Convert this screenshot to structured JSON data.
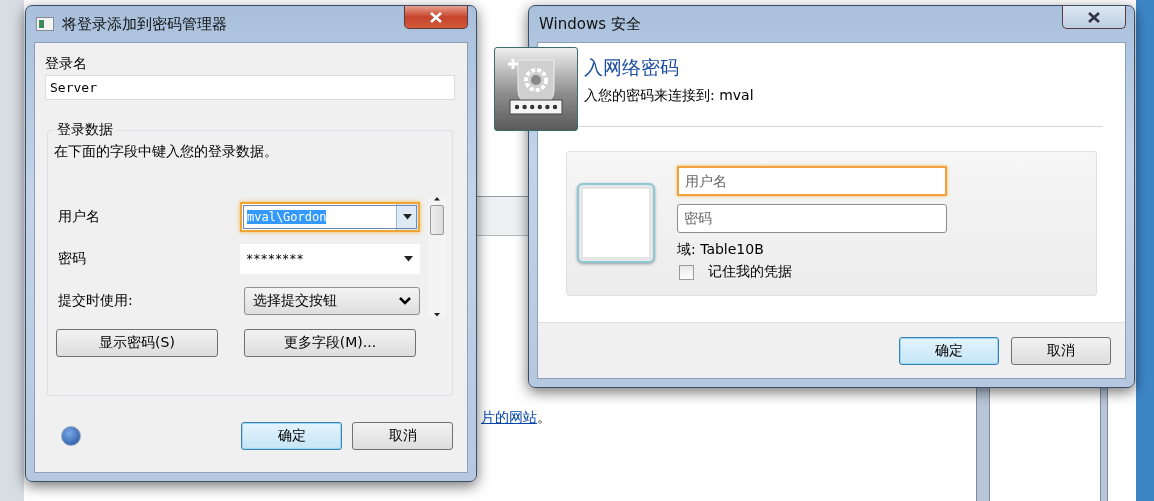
{
  "background_page": {
    "link": "片的网站",
    "after_link": "。"
  },
  "login_dialog": {
    "title": "将登录添加到密码管理器",
    "login_name_label": "登录名",
    "login_name_value": "Server",
    "group_title": "登录数据",
    "group_description": "在下面的字段中键入您的登录数据。",
    "fields": [
      {
        "label": "用户名",
        "value": "mval\\Gordon",
        "kind": "combo",
        "focused": true
      },
      {
        "label": "密码",
        "value": "********",
        "kind": "combo",
        "focused": false
      },
      {
        "label": "提交时使用:",
        "value": "选择提交按钮",
        "kind": "select",
        "focused": false
      }
    ],
    "field_buttons": [
      "显示密码(S)",
      "更多字段(M)..."
    ],
    "buttons": [
      {
        "label": "确定",
        "default": true
      },
      {
        "label": "取消",
        "default": false
      }
    ]
  },
  "security_dialog": {
    "title": "Windows 安全",
    "heading": "入网络密码",
    "subtitle": "入您的密码来连接到: mval",
    "inputs": [
      {
        "placeholder": "用户名",
        "focused": true
      },
      {
        "placeholder": "密码",
        "focused": false
      }
    ],
    "domain": "域: Table10B",
    "remember": {
      "label": "记住我的凭据",
      "checked": false
    },
    "buttons": [
      {
        "label": "确定",
        "default": true
      },
      {
        "label": "取消",
        "default": false
      }
    ]
  }
}
